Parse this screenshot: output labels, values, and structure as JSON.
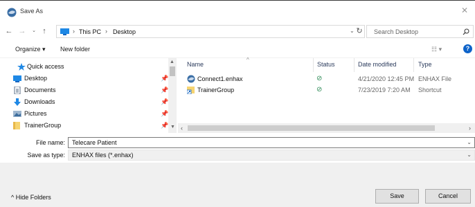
{
  "window": {
    "title": "Save As"
  },
  "address": {
    "crumbs": [
      "This PC",
      "Desktop"
    ]
  },
  "search": {
    "placeholder": "Search Desktop"
  },
  "toolbar": {
    "organize_label": "Organize ▾",
    "new_folder_label": "New folder"
  },
  "nav": {
    "items": [
      {
        "label": "Quick access"
      },
      {
        "label": "Desktop"
      },
      {
        "label": "Documents"
      },
      {
        "label": "Downloads"
      },
      {
        "label": "Pictures"
      },
      {
        "label": "TrainerGroup"
      }
    ]
  },
  "columns": {
    "name": "Name",
    "status": "Status",
    "date": "Date modified",
    "type": "Type"
  },
  "files": [
    {
      "name": "Connect1.enhax",
      "status": "⊘",
      "date": "4/21/2020 12:45 PM",
      "type": "ENHAX File"
    },
    {
      "name": "TrainerGroup",
      "status": "⊘",
      "date": "7/23/2019 7:20 AM",
      "type": "Shortcut"
    }
  ],
  "form": {
    "file_name_label": "File name:",
    "file_name_value": "Telecare Patient",
    "save_type_label": "Save as type:",
    "save_type_value": "ENHAX files (*.enhax)"
  },
  "footer": {
    "hide_folders_label": "Hide Folders",
    "save_label": "Save",
    "cancel_label": "Cancel"
  },
  "colors": {
    "accent": "#0e63c9",
    "status_ok": "#2e8b57",
    "panel": "#f0f0f0"
  }
}
